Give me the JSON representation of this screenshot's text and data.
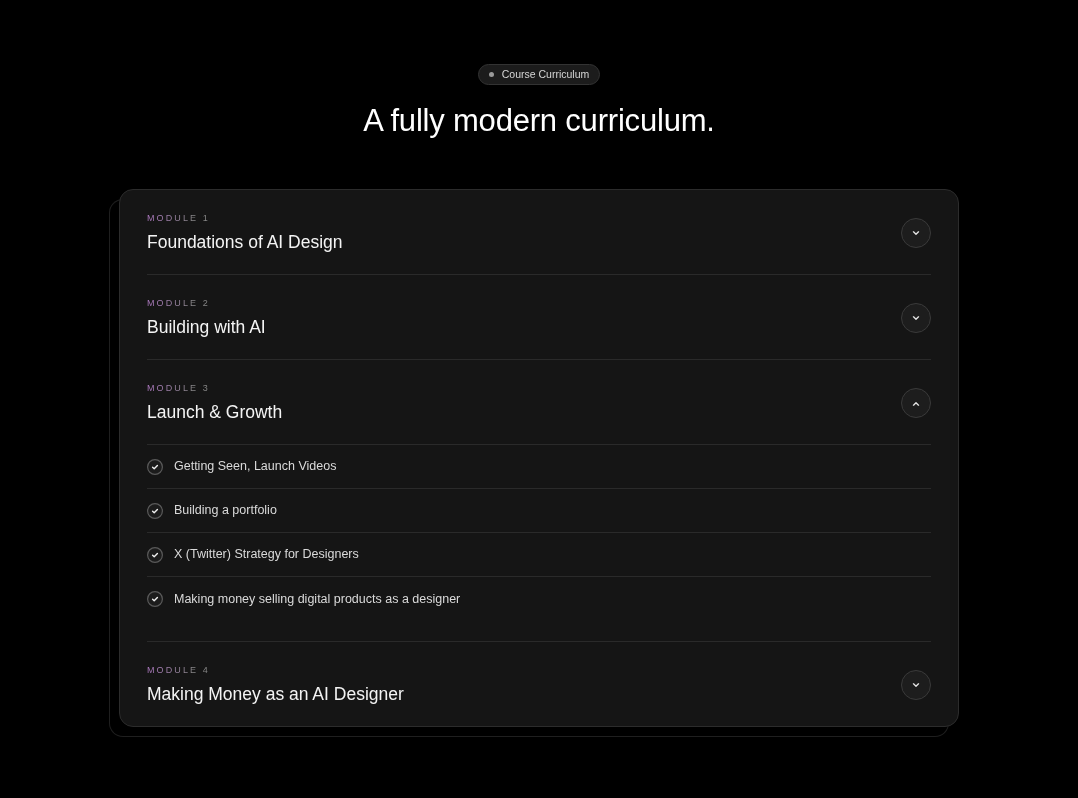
{
  "badge": {
    "label": "Course Curriculum"
  },
  "heading": "A fully modern curriculum.",
  "modules": [
    {
      "label": "MODULE 1",
      "title": "Foundations of AI Design",
      "expanded": false
    },
    {
      "label": "MODULE 2",
      "title": "Building with AI",
      "expanded": false
    },
    {
      "label": "MODULE 3",
      "title": "Launch & Growth",
      "expanded": true,
      "lessons": [
        {
          "title": "Getting Seen, Launch Videos"
        },
        {
          "title": "Building a portfolio"
        },
        {
          "title": "X (Twitter) Strategy for Designers"
        },
        {
          "title": "Making money selling digital products as a designer"
        }
      ]
    },
    {
      "label": "MODULE 4",
      "title": "Making Money as an AI Designer",
      "expanded": false
    }
  ]
}
